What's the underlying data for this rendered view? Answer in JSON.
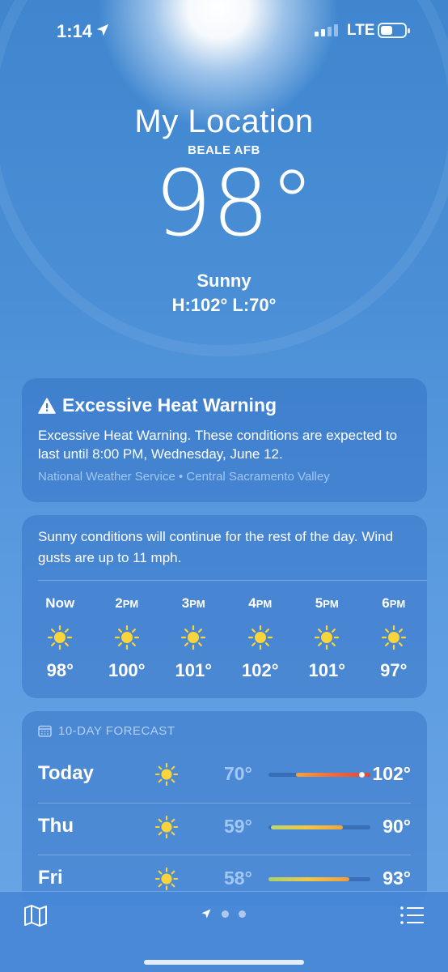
{
  "status_bar": {
    "time": "1:14",
    "network": "LTE"
  },
  "header": {
    "title": "My Location",
    "subtitle": "BEALE AFB",
    "temperature": "98°",
    "condition": "Sunny",
    "high_low": "H:102°  L:70°"
  },
  "alert": {
    "title": "Excessive Heat Warning",
    "body": "Excessive Heat Warning. These conditions are expected to last until 8:00 PM, Wednesday, June 12.",
    "source": "National Weather Service • Central Sacramento Valley"
  },
  "hourly": {
    "summary": "Sunny conditions will continue for the rest of the day. Wind gusts are up to 11 mph.",
    "hours": [
      {
        "label": "Now",
        "suffix": "",
        "icon": "sun-icon",
        "temp": "98°"
      },
      {
        "label": "2",
        "suffix": "PM",
        "icon": "sun-icon",
        "temp": "100°"
      },
      {
        "label": "3",
        "suffix": "PM",
        "icon": "sun-icon",
        "temp": "101°"
      },
      {
        "label": "4",
        "suffix": "PM",
        "icon": "sun-icon",
        "temp": "102°"
      },
      {
        "label": "5",
        "suffix": "PM",
        "icon": "sun-icon",
        "temp": "101°"
      },
      {
        "label": "6",
        "suffix": "PM",
        "icon": "sun-icon",
        "temp": "97°"
      }
    ]
  },
  "forecast": {
    "header": "10-DAY FORECAST",
    "range_min": 58,
    "range_max": 102,
    "days": [
      {
        "day": "Today",
        "icon": "sun-icon",
        "low": "70°",
        "high": "102°",
        "low_val": 70,
        "high_val": 102,
        "current_val": 98,
        "gradient": "linear-gradient(90deg,#f4a340,#f06a3a,#e8433a)"
      },
      {
        "day": "Thu",
        "icon": "sun-icon",
        "low": "59°",
        "high": "90°",
        "low_val": 59,
        "high_val": 90,
        "gradient": "linear-gradient(90deg,#b9d86a,#f2c744,#f3a43c)"
      },
      {
        "day": "Fri",
        "icon": "sun-icon",
        "low": "58°",
        "high": "93°",
        "low_val": 58,
        "high_val": 93,
        "gradient": "linear-gradient(90deg,#a9d46c,#f2c744,#f39a3a)"
      }
    ]
  },
  "colors": {
    "sun": "#f9d43a",
    "accent_text": "#c8e1ff"
  }
}
